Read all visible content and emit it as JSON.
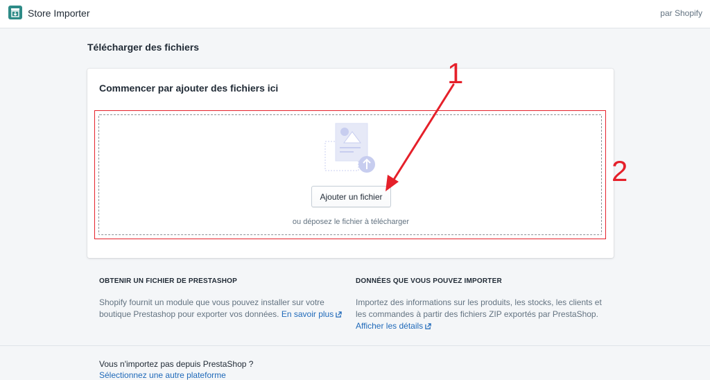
{
  "header": {
    "app_title": "Store Importer",
    "vendor": "par Shopify",
    "logo_icon": "store-importer-logo-icon"
  },
  "page": {
    "title": "Télécharger des fichiers"
  },
  "upload_card": {
    "title": "Commencer par ajouter des fichiers ici",
    "button_label": "Ajouter un fichier",
    "drop_hint": "ou déposez le fichier à télécharger"
  },
  "annotations": {
    "label_one": "1",
    "label_two": "2",
    "color": "#e5202a"
  },
  "info": {
    "left": {
      "heading": "OBTENIR UN FICHIER DE PRESTASHOP",
      "body": "Shopify fournit un module que vous pouvez installer sur votre boutique Prestashop pour exporter vos données.",
      "link": "En savoir plus"
    },
    "right": {
      "heading": "DONNÉES QUE VOUS POUVEZ IMPORTER",
      "body": "Importez des informations sur les produits, les stocks, les clients et les commandes à partir des fichiers ZIP exportés par PrestaShop.",
      "link": "Afficher les détails"
    }
  },
  "footer": {
    "question": "Vous n'importez pas depuis PrestaShop ?",
    "link": "Sélectionnez une autre plateforme"
  },
  "colors": {
    "brand": "#2e8b87",
    "link": "#1f69b9",
    "background": "#f4f6f8"
  }
}
